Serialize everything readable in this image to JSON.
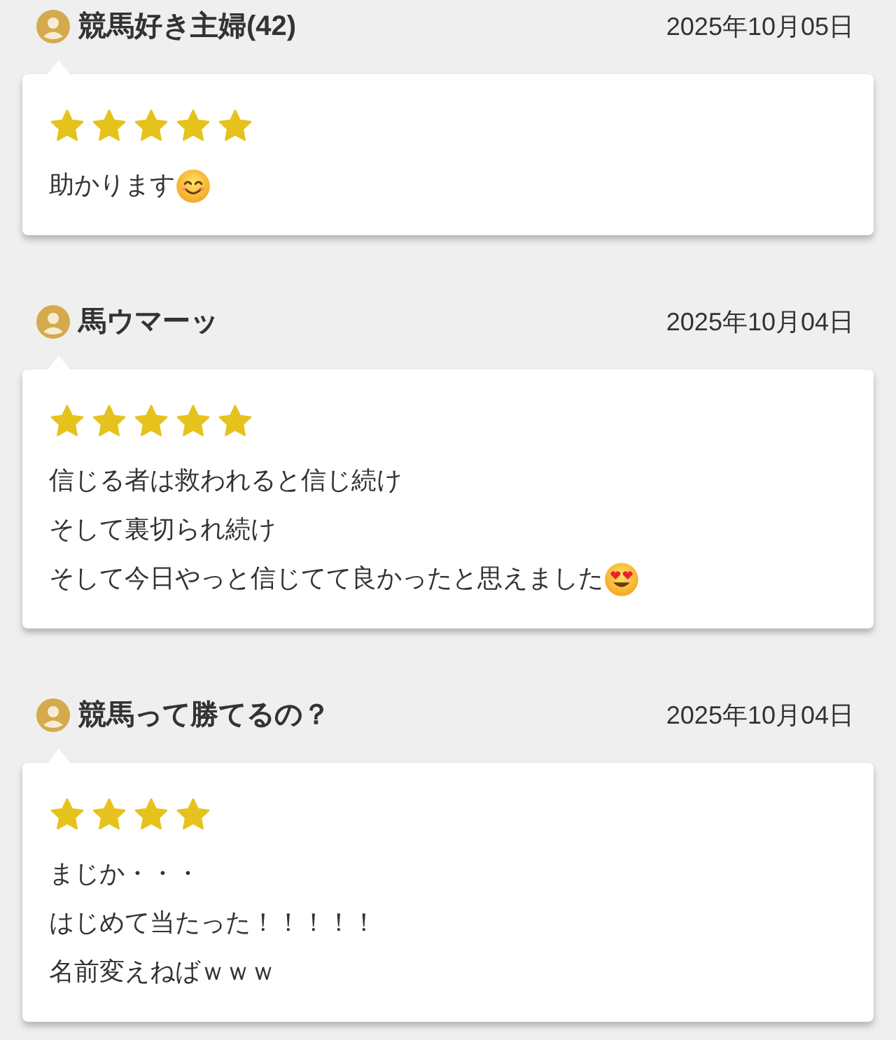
{
  "reviews": [
    {
      "author": "競馬好き主婦(42)",
      "date": "2025年10月05日",
      "stars": 5,
      "lines": [
        {
          "text": "助かります",
          "kind": "smiling_emoji"
        }
      ]
    },
    {
      "author": "馬ウマーッ",
      "date": "2025年10月04日",
      "stars": 5,
      "lines": [
        {
          "text": "信じる者は救われると信じ続け",
          "kind": "plain"
        },
        {
          "text": "そして裏切られ続け",
          "kind": "plain"
        },
        {
          "text": "そして今日やっと信じてて良かったと思えました",
          "kind": "heart_eyes_emoji"
        }
      ]
    },
    {
      "author": "競馬って勝てるの？",
      "date": "2025年10月04日",
      "stars": 4,
      "lines": [
        {
          "text": "まじか・・・",
          "kind": "plain"
        },
        {
          "text": "はじめて当たった！！！！！",
          "kind": "plain"
        },
        {
          "text": "名前変えねばｗｗｗ",
          "kind": "plain"
        }
      ]
    }
  ]
}
